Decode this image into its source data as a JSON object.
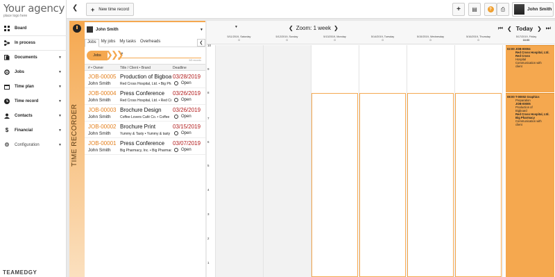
{
  "logo": {
    "name": "Your agency",
    "sub": "place logo here"
  },
  "sidebar": {
    "items": [
      {
        "label": "Board",
        "icon": "grid-icon",
        "caret": false
      },
      {
        "label": "In process",
        "icon": "flow-icon",
        "caret": false
      },
      {
        "label": "Documents",
        "icon": "documents-icon",
        "caret": true
      },
      {
        "label": "Jobs",
        "icon": "jobs-icon",
        "caret": true
      },
      {
        "label": "Time plan",
        "icon": "timeplan-icon",
        "caret": true
      },
      {
        "label": "Time record",
        "icon": "clock-icon",
        "caret": true
      },
      {
        "label": "Contacts",
        "icon": "contacts-icon",
        "caret": true
      },
      {
        "label": "Financial",
        "icon": "dollar-icon",
        "caret": true
      },
      {
        "label": "Configuration",
        "icon": "gear-icon",
        "caret": true
      }
    ],
    "brand": "TEAMEDGY"
  },
  "toolbar": {
    "new_record_label": "New time record",
    "user_name": "John Smith"
  },
  "recorder": {
    "label": "TIME RECORDER",
    "owner": "John Smith",
    "tabs": [
      "Jobs",
      "My jobs",
      "My tasks",
      "Overheads"
    ],
    "filter": "Jobs",
    "records_count": "5/5 records",
    "columns": {
      "num": "# • Owner",
      "title": "Title / Client • Brand",
      "deadline": "Deadline"
    },
    "jobs": [
      {
        "num": "JOB-00005",
        "title": "Production of Bigboard",
        "owner": "John Smith",
        "client": "Red Cross Hospital, Ltd. • Big Pharmacy",
        "deadline": "03/28/2019",
        "status": "Open"
      },
      {
        "num": "JOB-00004",
        "title": "Press Conference",
        "owner": "John Smith",
        "client": "Red Cross Hospital, Ltd. • Red Cross",
        "deadline": "03/26/2019",
        "status": "Open"
      },
      {
        "num": "JOB-00003",
        "title": "Brochure Design",
        "owner": "John Smith",
        "client": "Coffee Lovers Café Co. • Coffee",
        "deadline": "03/26/2019",
        "status": "Open"
      },
      {
        "num": "JOB-00002",
        "title": "Brochure Print",
        "owner": "John Smith",
        "client": "Yummy & Tasty • Yummy & tasty",
        "deadline": "03/15/2019",
        "status": "Open"
      },
      {
        "num": "JOB-00001",
        "title": "Press Conference",
        "owner": "John Smith",
        "client": "Big Pharmacy, Inc. • Big Pharmacy",
        "deadline": "03/07/2019",
        "status": "Open"
      }
    ]
  },
  "calendar": {
    "zoom_label": "Zoom: 1 week",
    "today_label": "Today",
    "days": [
      {
        "label": "5/11/2019, Saturday",
        "count": "0"
      },
      {
        "label": "5/12/2019, Sunday",
        "count": "0"
      },
      {
        "label": "5/13/2019, Monday",
        "count": "0"
      },
      {
        "label": "5/14/2019, Tuesday",
        "count": "0"
      },
      {
        "label": "5/15/2019, Wednesday",
        "count": "0"
      },
      {
        "label": "5/16/2019, Thursday",
        "count": "0"
      },
      {
        "label": "5/17/2019, Friday",
        "count": "16:00"
      }
    ],
    "hours": [
      "10",
      "9",
      "8",
      "7",
      "6",
      "5",
      "4",
      "3",
      "2",
      "1"
    ],
    "events": [
      {
        "time": "02:00",
        "lines": [
          "JOB-00004",
          "Red Cross Hospital, Ltd.",
          "Red Cross",
          "Hospital",
          "Communication with",
          "client"
        ]
      },
      {
        "time": "08:00",
        "lines": [
          "T-00002 Graphics",
          "Preparation",
          "JOB-00005",
          "Production of",
          "Bigboard",
          "Red Cross Hospital, Ltd.",
          "Big Pharmacy",
          "Communication with",
          "client"
        ]
      }
    ]
  }
}
